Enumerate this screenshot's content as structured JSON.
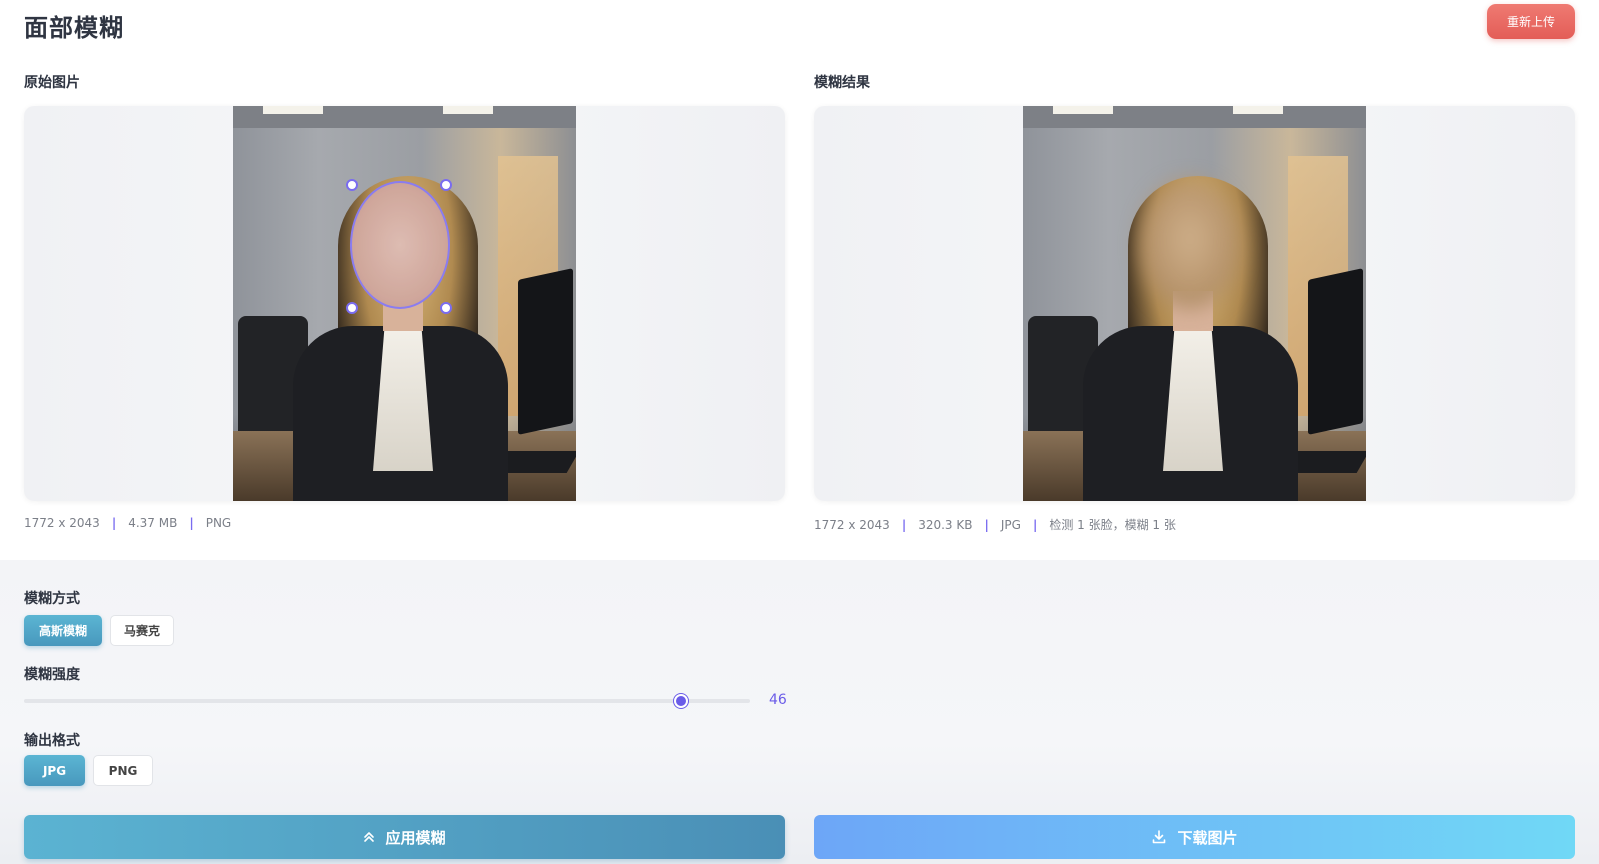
{
  "header": {
    "title": "面部模糊",
    "reupload_label": "重新上传"
  },
  "original": {
    "label": "原始图片",
    "meta": {
      "dimensions": "1772 x 2043",
      "size": "4.37 MB",
      "format": "PNG"
    }
  },
  "result": {
    "label": "模糊结果",
    "meta": {
      "dimensions": "1772 x 2043",
      "size": "320.3 KB",
      "format": "JPG",
      "detection": "检测 1 张脸，模糊 1 张"
    }
  },
  "controls": {
    "blur_mode": {
      "label": "模糊方式",
      "options": [
        "高斯模糊",
        "马赛克"
      ],
      "selected": "高斯模糊"
    },
    "strength": {
      "label": "模糊强度",
      "value": "46"
    },
    "output_format": {
      "label": "输出格式",
      "options": [
        "JPG",
        "PNG"
      ],
      "selected": "JPG"
    }
  },
  "actions": {
    "apply_label": "应用模糊",
    "download_label": "下载图片"
  },
  "colors": {
    "accent": "#6a5ce8",
    "primary_button": "#4a8fb6",
    "danger_button": "#e35d57"
  },
  "icons": {
    "apply": "double-chevron-up-icon",
    "download": "download-icon"
  }
}
